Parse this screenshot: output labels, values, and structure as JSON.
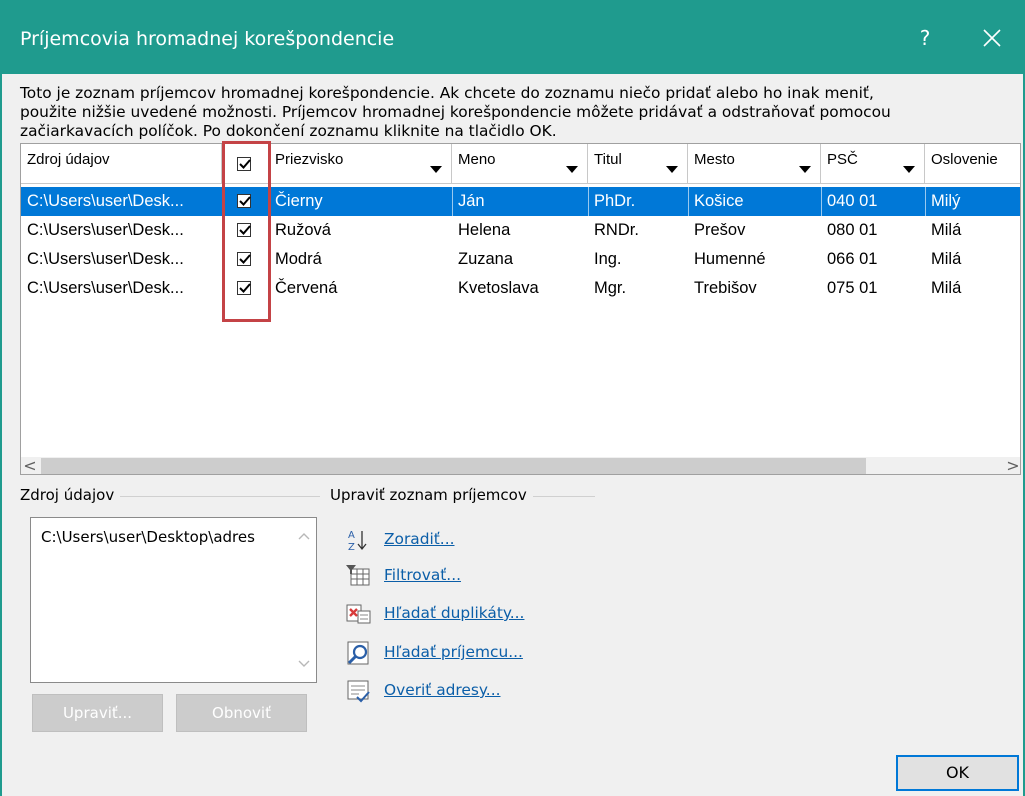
{
  "window": {
    "title": "Príjemcovia hromadnej korešpondencie",
    "help_label": "?",
    "close_label": "✕"
  },
  "description": "Toto je zoznam príjemcov hromadnej korešpondencie. Ak chcete do zoznamu niečo pridať alebo ho inak meniť,\npoužite nižšie uvedené možnosti. Príjemcov hromadnej korešpondencie môžete pridávať a odstraňovať pomocou\nzačiarkavacích políčok. Po dokončení zoznamu kliknite na tlačidlo OK.",
  "table": {
    "columns": [
      "Zdroj údajov",
      "",
      "Priezvisko",
      "Meno",
      "Titul",
      "Mesto",
      "PSČ",
      "Oslovenie"
    ],
    "header_checked": true,
    "rows": [
      {
        "source": "C:\\Users\\user\\Desk...",
        "checked": true,
        "priezvisko": "Čierny",
        "meno": "Ján",
        "titul": "PhDr.",
        "mesto": "Košice",
        "psc": "040 01",
        "oslovenie": "Milý",
        "selected": true
      },
      {
        "source": "C:\\Users\\user\\Desk...",
        "checked": true,
        "priezvisko": "Ružová",
        "meno": "Helena",
        "titul": "RNDr.",
        "mesto": "Prešov",
        "psc": "080 01",
        "oslovenie": "Milá",
        "selected": false
      },
      {
        "source": "C:\\Users\\user\\Desk...",
        "checked": true,
        "priezvisko": "Modrá",
        "meno": "Zuzana",
        "titul": "Ing.",
        "mesto": "Humenné",
        "psc": "066 01",
        "oslovenie": "Milá",
        "selected": false
      },
      {
        "source": "C:\\Users\\user\\Desk...",
        "checked": true,
        "priezvisko": "Červená",
        "meno": "Kvetoslava",
        "titul": "Mgr.",
        "mesto": "Trebišov",
        "psc": "075 01",
        "oslovenie": "Milá",
        "selected": false
      }
    ],
    "scroll_left": "<",
    "scroll_right": ">"
  },
  "data_source": {
    "title": "Zdroj údajov",
    "items": [
      "C:\\Users\\user\\Desktop\\adres"
    ],
    "edit_label": "Upraviť...",
    "refresh_label": "Obnoviť"
  },
  "refine": {
    "title": "Upraviť zoznam príjemcov",
    "links": [
      {
        "label": "Zoradiť...",
        "icon": "sort-az-icon"
      },
      {
        "label": "Filtrovať...",
        "icon": "filter-icon"
      },
      {
        "label": "Hľadať duplikáty...",
        "icon": "find-duplicates-icon"
      },
      {
        "label": "Hľadať príjemcu...",
        "icon": "find-recipient-icon"
      },
      {
        "label": "Overiť adresy...",
        "icon": "validate-addresses-icon"
      }
    ]
  },
  "ok_label": "OK",
  "colors": {
    "titlebar": "#1f9b8e",
    "selection": "#0078d7",
    "highlight": "#c44346",
    "link": "#0b5ea8"
  }
}
